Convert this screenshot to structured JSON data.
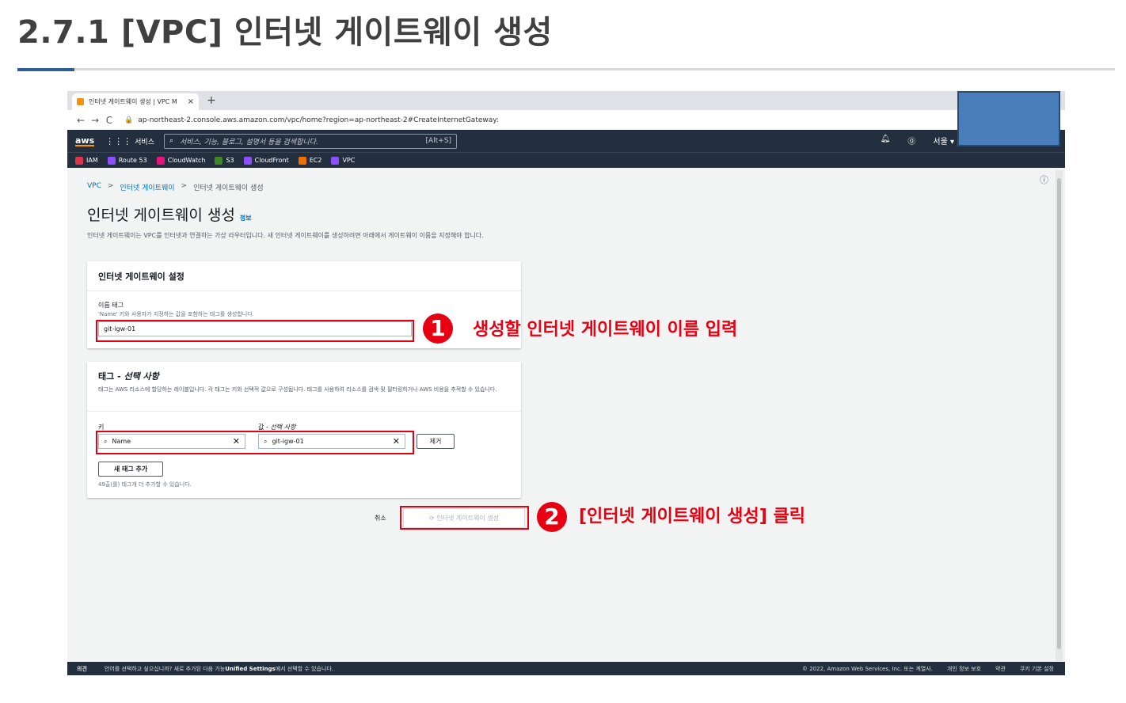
{
  "slide": {
    "title": "2.7.1 [VPC] 인터넷 게이트웨이 생성"
  },
  "browser": {
    "tab_title": "인터넷 게이트웨이 생성 | VPC M",
    "tab_close": "×",
    "new_tab": "+",
    "url": "ap-northeast-2.console.aws.amazon.com/vpc/home?region=ap-northeast-2#CreateInternetGateway:"
  },
  "aws_nav": {
    "logo": "aws",
    "services": "서비스",
    "search_placeholder": "서비스, 기능, 블로그, 설명서 등을 검색합니다.",
    "search_shortcut": "[Alt+S]",
    "region": "서울 ▾"
  },
  "favorites": [
    {
      "label": "IAM",
      "color": "#dd344c"
    },
    {
      "label": "Route 53",
      "color": "#8c4fff"
    },
    {
      "label": "CloudWatch",
      "color": "#e7157b"
    },
    {
      "label": "S3",
      "color": "#3f8624"
    },
    {
      "label": "CloudFront",
      "color": "#8c4fff"
    },
    {
      "label": "EC2",
      "color": "#ed7100"
    },
    {
      "label": "VPC",
      "color": "#8c4fff"
    }
  ],
  "breadcrumb": {
    "vpc": "VPC",
    "igw": "인터넷 게이트웨이",
    "current": "인터넷 게이트웨이 생성"
  },
  "page": {
    "title": "인터넷 게이트웨이 생성",
    "info": "정보",
    "description": "인터넷 게이트웨이는 VPC를 인터넷과 연결하는 가상 라우터입니다. 새 인터넷 게이트웨이를 생성하려면 아래에서 게이트웨이 이름을 지정해야 합니다."
  },
  "settings": {
    "header": "인터넷 게이트웨이 설정",
    "name_label": "이름 태그",
    "name_hint": "'Name' 키와 사용자가 지정하는 값을 포함하는 태그를 생성합니다.",
    "name_value": "git-igw-01"
  },
  "tags": {
    "title": "태그 - ",
    "title_optional": "선택 사항",
    "description": "태그는 AWS 리소스에 할당하는 레이블입니다. 각 태그는 키와 선택적 값으로 구성됩니다. 태그를 사용하여 리소스를 검색 및 필터링하거나 AWS 비용을 추적할 수 있습니다.",
    "key_label": "키",
    "value_label": "값 - ",
    "value_optional": "선택 사항",
    "key_value": "Name",
    "value_value": "git-igw-01",
    "remove": "제거",
    "add": "새 태그 추가",
    "limit": "49출(를) 태그개 더 추가할 수 있습니다."
  },
  "actions": {
    "cancel": "취소",
    "create": "인터넷 게이트웨이 생성"
  },
  "footer": {
    "feedback": "의견",
    "message_prefix": "언어를 선택하고 싶으십니까? 새로 추가된 다음 기능",
    "message_link": "Unified Settings",
    "message_suffix": "에서 선택할 수 있습니다.",
    "copyright": "© 2022, Amazon Web Services, Inc. 또는 계열사.",
    "privacy": "개인 정보 보호",
    "terms": "약관",
    "cookies": "쿠키 기본 설정"
  },
  "annotations": {
    "step1_num": "1",
    "step1_text": "생성할 인터넷 게이트웨이 이름 입력",
    "step2_num": "2",
    "step2_text": "[인터넷 게이트웨이 생성] 클릭",
    "accent_color": "#e60012"
  }
}
